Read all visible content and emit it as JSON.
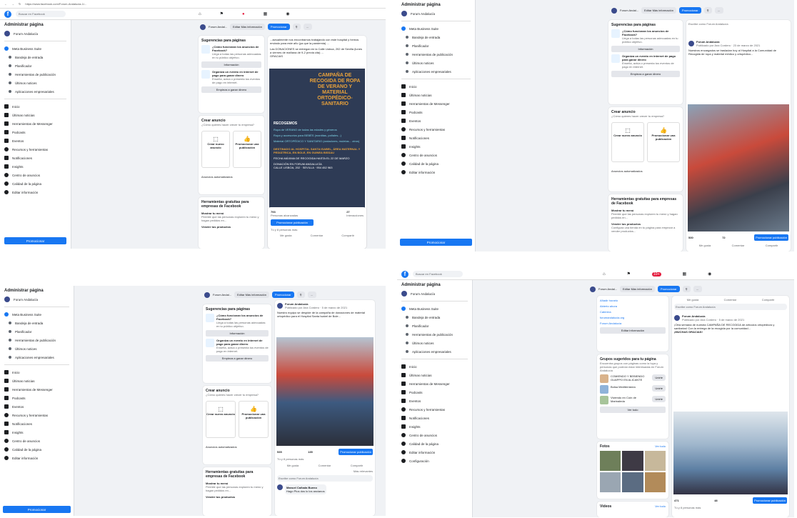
{
  "browser": {
    "url": "https://www.facebook.com/Forum-Andalucia-1/..."
  },
  "search": {
    "placeholder": "Buscar en Facebook"
  },
  "sidebar": {
    "title": "Administrar página",
    "page": "Forum Andalucía",
    "suite": "Meta Business Suite",
    "suite_items": [
      "Bandeja de entrada",
      "Planificador",
      "Herramientas de publicación",
      "Últimos notices",
      "Aplicaciones empresariales"
    ],
    "items": [
      {
        "label": "Inicio"
      },
      {
        "label": "Últimas noticias",
        "sub": "8 nuevos"
      },
      {
        "label": "Herramientas de Messenger"
      },
      {
        "label": "Podcasts"
      },
      {
        "label": "Eventos"
      },
      {
        "label": "Recursos y herramientas"
      },
      {
        "label": "Notificaciones",
        "sub": "20 nuevos"
      },
      {
        "label": "Insights"
      },
      {
        "label": "Centro de anuncios"
      },
      {
        "label": "Calidad de la página"
      },
      {
        "label": "Editar información"
      },
      {
        "label": "Configuración"
      }
    ],
    "promote": "Promocionar"
  },
  "header": {
    "page_short": "Forum Andal...",
    "edit_info": "Editar Más información",
    "promote": "Promocionar"
  },
  "suggestions": {
    "title": "Sugerencias para páginas",
    "see_all": "Ver todo",
    "q1": "¿Cómo funcionan los anuncios de Facebook?",
    "q1_text": "Llega a todas las personas adecuadas en tu público objetivo.",
    "info_btn": "Información",
    "q2": "Organiza un evento en internet de pago para ganar dinero",
    "q2_text": "Enseña, actúa o presenta tus eventos de pago en internet.",
    "earn_btn": "Empieza a ganar dinero"
  },
  "ads": {
    "title": "Crear anuncio",
    "subtitle": "¿Cómo quieres hacer crecer tu empresa?",
    "see_all": "Ver todo",
    "create": "Crear nuevo anuncio",
    "promote_pub": "Promocionar una publicación",
    "auto": "Anuncios automatizados"
  },
  "tools": {
    "title": "Herramientas gratuitas para empresas de Facebook",
    "item1": "Mostrar tu menú",
    "item1_text": "Permite que las personas exploren tu menú y hagan pedidos en...",
    "item2": "Vender tus productos",
    "item2_text": "Configura una tienda en tu página para empezar a vender productos..."
  },
  "post1": {
    "text": "...actualmente nos encontramos trabajando con este hospital y hemos enviado para este año (ya que la pandemia) ...",
    "donate": "Las DONACIONES se entregan en la Calle Lisboa, 202 de Sevilla (lunes a viernes de mañana de 9-2 previa cita) ...",
    "thanks": "GRACIAS"
  },
  "poster": {
    "title": "CAMPAÑA DE RECOGIDA DE ROPA DE VERANO Y MATERIAL ORTOPÉDICO-SANITARIO",
    "collect": "RECOGEMOS",
    "bullet1": "Ropa de VERANO de todas las edades y géneros",
    "bullet2": "Ropa y accesorios para BEBÉS (mantitas, pañales...)",
    "bullet3": "Material ORTOPÉDICO Y SANITARIO (andadores, muletas... otros)",
    "dest": "DESTINADO AL HOSPITAL SANTA ISABEL, ÁREA MATERNAL Y PEDIÁTRICA, EN BOLE, EN GUINEA BISSAU",
    "deadline": "FECHA MÁXIMA DE RECOGIDA HASTA EL 22 DE MARZO",
    "place": "DONACIÓN EN FORUM ANDALUCÍA",
    "address": "CALLE LISBOA, 202 · SEVILLA · 954 452 963"
  },
  "stats": {
    "reach": "793",
    "reach_label": "Personas alcanzadas",
    "interactions": "27",
    "int_label": "Interacciones",
    "promote_pub": "Promocionar publicación",
    "likes": "Tú y 8 personas más",
    "shares": "1 vez compartida"
  },
  "actions": {
    "like": "Me gusta",
    "comment": "Comentar",
    "share": "Compartir"
  },
  "post2": {
    "author": "Forum Andalucía",
    "date": "Publicado por Ana Cordero · 23 de marzo de 2021",
    "text": "Nuestros encargados se trasladan hoy al Hospital a la Comunidad de Recogida de ropa y material médico y ortopédico...",
    "reach": "530",
    "interactions": "72"
  },
  "post3": {
    "author": "Forum Andalucía",
    "date": "Publicado por Ana Cordero · 5 de marzo de 2021",
    "text": "Nuestro equipo se despide de la campaña de donaciones de material ortopédico para el Hospital Santa Isabel de Bole...",
    "reach": "535",
    "interactions": "135",
    "comment_ph": "Escribe como Forum Andalucía",
    "commenter": "Manuel Cañada Bueno",
    "comment": "Hago Plus dos lo los ancianos",
    "prev": "Más relevantes"
  },
  "groups": {
    "title": "Grupos sugeridos para tu página",
    "subtitle": "Encuentra grupos con páginas como la tuya y personas que podrían estar interesadas en Forum Andalucía",
    "g1": "COMIENDO Y BEBIENDO GUAPPO EN ALICANTE",
    "g2": "Bolsa Mediterránea",
    "g3": "Viviendo en Coín de Marinaleda",
    "join": "Unirte",
    "see_all": "Ver todo"
  },
  "photos": {
    "title": "Fotos",
    "see_all": "Ver todo"
  },
  "videos": {
    "title": "Videos",
    "see_all": "Ver todo"
  },
  "page_info": {
    "edit": "Editar información",
    "open": "Abierto ahora",
    "web": "forumandalucia.org",
    "cat": "Caterera",
    "inc": "Añadir horario",
    "sub": "Forum Andalucía",
    "site": "Sitio web"
  },
  "post4": {
    "text": "¡Otra semana de nuestra CAMPAÑA DE RECOGIDA de artículos ortopédicos y sanitarios! Con la entrega de la recogida por la comunidad...",
    "thanks": "¡MUCHAS GRACIAS!",
    "reach": "471",
    "interactions": "48"
  },
  "notif_count": "10+"
}
